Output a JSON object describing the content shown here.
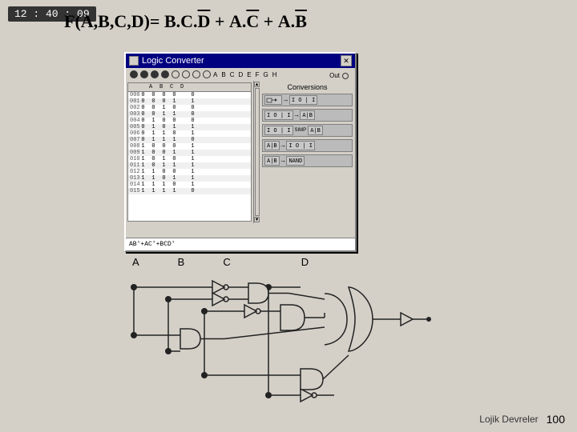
{
  "topbar": {
    "time": "12 : 40 : 09"
  },
  "formula": {
    "text": "F(A,B,C,D)= B.C.D + A.C + A.B",
    "display": "F(A,B,C,D)= B·C·D̄ + A·C̄ + A·B̄"
  },
  "window": {
    "title": "Logic Converter",
    "close_btn": "✕",
    "inputs_label": "A  B  C  D  E  F  G  H",
    "out_label": "Out"
  },
  "conversions": {
    "title": "Conversions",
    "rows": [
      {
        "left": "⊞",
        "arrow": "→",
        "right": "I O | I"
      },
      {
        "left": "I O | I",
        "arrow": "→",
        "right": "A|B"
      },
      {
        "left": "I O | I",
        "arrow": "SIMP",
        "right": "A|B"
      },
      {
        "left": "A|B",
        "arrow": "→",
        "right": "I O | I"
      },
      {
        "left": "A|B",
        "arrow": "→",
        "right": "NAND"
      }
    ]
  },
  "formula_bar": {
    "text": "AB'+AC'+BCD'"
  },
  "truth_table": {
    "headers": [
      "",
      "A",
      "B",
      "C",
      "D",
      "",
      ""
    ],
    "rows": [
      [
        "000",
        "0",
        "0",
        "0",
        "0",
        "",
        "0"
      ],
      [
        "001",
        "0",
        "0",
        "0",
        "1",
        "",
        "1"
      ],
      [
        "002",
        "0",
        "0",
        "1",
        "0",
        "",
        "0"
      ],
      [
        "003",
        "0",
        "0",
        "1",
        "1",
        "",
        "0"
      ],
      [
        "004",
        "0",
        "1",
        "0",
        "0",
        "",
        "0"
      ],
      [
        "005",
        "0",
        "1",
        "0",
        "1",
        "",
        "1"
      ],
      [
        "006",
        "0",
        "1",
        "1",
        "0",
        "",
        "1"
      ],
      [
        "007",
        "0",
        "1",
        "1",
        "1",
        "",
        "0"
      ],
      [
        "008",
        "1",
        "0",
        "0",
        "0",
        "",
        "1"
      ],
      [
        "009",
        "1",
        "0",
        "0",
        "1",
        "",
        "1"
      ],
      [
        "010",
        "1",
        "0",
        "1",
        "0",
        "",
        "1"
      ],
      [
        "011",
        "1",
        "0",
        "1",
        "1",
        "",
        "1"
      ],
      [
        "012",
        "1",
        "1",
        "0",
        "0",
        "",
        "1"
      ],
      [
        "013",
        "1",
        "1",
        "0",
        "1",
        "",
        "1"
      ],
      [
        "014",
        "1",
        "1",
        "1",
        "0",
        "",
        "1"
      ],
      [
        "015",
        "1",
        "1",
        "1",
        "1",
        "",
        "0"
      ]
    ]
  },
  "circuit": {
    "labels": [
      "A",
      "B",
      "C",
      "D"
    ]
  },
  "footer": {
    "label": "Lojik Devreler",
    "page": "100"
  }
}
